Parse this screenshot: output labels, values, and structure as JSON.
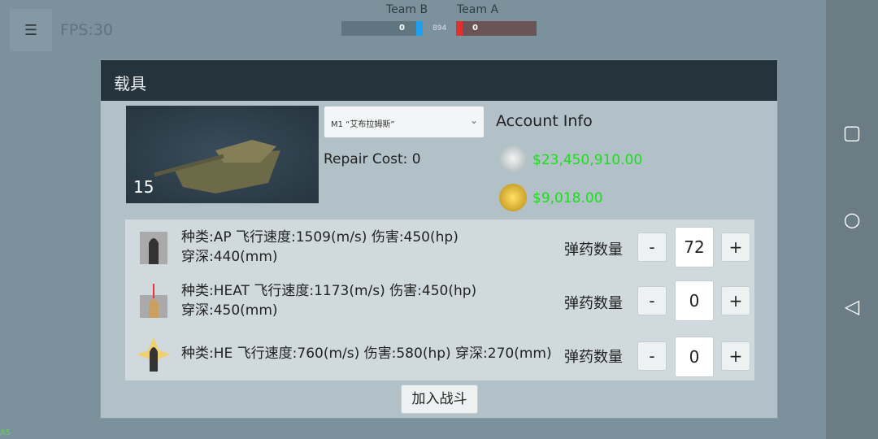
{
  "hud": {
    "menu_icon": "hamburger-icon",
    "fps": "FPS:30",
    "team_b": "Team B",
    "team_a": "Team A",
    "team_b_score": "0",
    "team_a_score": "0",
    "center_value": "894",
    "team_b_color": "#1ea0f0",
    "team_a_color": "#e03030"
  },
  "panel": {
    "title": "载具",
    "vehicle_level": "15",
    "vehicle_select": "M1 “艾布拉姆斯”",
    "repair_cost": "Repair Cost: 0",
    "account_title": "Account Info",
    "silver": "$23,450,910.00",
    "gold": "$9,018.00"
  },
  "ammo": [
    {
      "line1": "种类:AP 飞行速度:1509(m/s) 伤害:450(hp)",
      "line2": "穿深:440(mm)",
      "qty_label": "弹药数量",
      "qty": "72",
      "minus": "-",
      "plus": "+"
    },
    {
      "line1": "种类:HEAT 飞行速度:1173(m/s) 伤害:450(hp)",
      "line2": "穿深:450(mm)",
      "qty_label": "弹药数量",
      "qty": "0",
      "minus": "-",
      "plus": "+"
    },
    {
      "line1": "种类:HE 飞行速度:760(m/s) 伤害:580(hp) 穿深:270(mm)",
      "line2": "",
      "qty_label": "弹药数量",
      "qty": "0",
      "minus": "-",
      "plus": "+"
    }
  ],
  "join_button": "加入战斗",
  "corner_text": "A5"
}
